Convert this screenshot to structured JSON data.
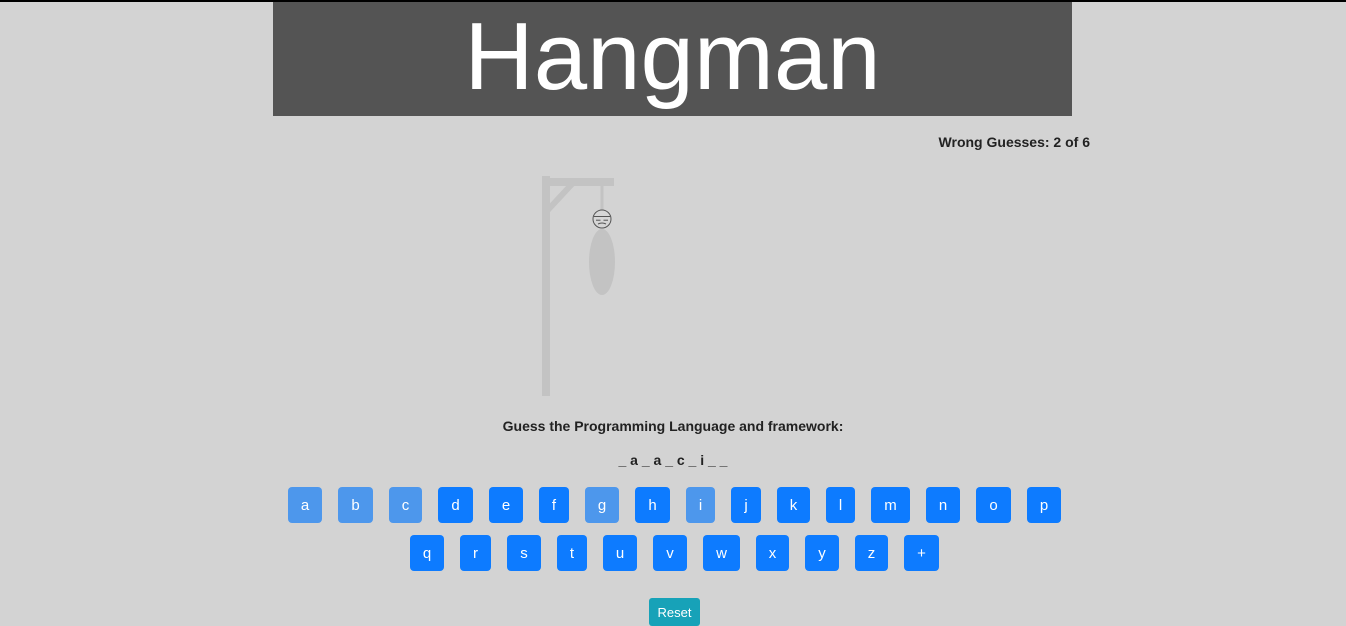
{
  "title": "Hangman",
  "wrong_guesses_text": "Wrong Guesses: 2 of 6",
  "wrong_guesses": 2,
  "max_wrong": 6,
  "prompt": "Guess the Programming Language and framework:",
  "word_display": "_ a _ a _ c _ i _ _",
  "keyboard": {
    "row1": [
      {
        "label": "a",
        "used": true
      },
      {
        "label": "b",
        "used": true
      },
      {
        "label": "c",
        "used": true
      },
      {
        "label": "d",
        "used": false
      },
      {
        "label": "e",
        "used": false
      },
      {
        "label": "f",
        "used": false
      },
      {
        "label": "g",
        "used": true
      },
      {
        "label": "h",
        "used": false
      },
      {
        "label": "i",
        "used": true
      },
      {
        "label": "j",
        "used": false
      },
      {
        "label": "k",
        "used": false
      },
      {
        "label": "l",
        "used": false
      },
      {
        "label": "m",
        "used": false
      },
      {
        "label": "n",
        "used": false
      },
      {
        "label": "o",
        "used": false
      },
      {
        "label": "p",
        "used": false
      }
    ],
    "row2": [
      {
        "label": "q",
        "used": false
      },
      {
        "label": "r",
        "used": false
      },
      {
        "label": "s",
        "used": false
      },
      {
        "label": "t",
        "used": false
      },
      {
        "label": "u",
        "used": false
      },
      {
        "label": "v",
        "used": false
      },
      {
        "label": "w",
        "used": false
      },
      {
        "label": "x",
        "used": false
      },
      {
        "label": "y",
        "used": false
      },
      {
        "label": "z",
        "used": false
      },
      {
        "label": "+",
        "used": false
      }
    ]
  },
  "reset_label": "Reset",
  "colors": {
    "background": "#d3d3d3",
    "banner": "#545454",
    "key": "#0d7bff",
    "key_used": "#4d97ec",
    "reset": "#17a2b8"
  }
}
